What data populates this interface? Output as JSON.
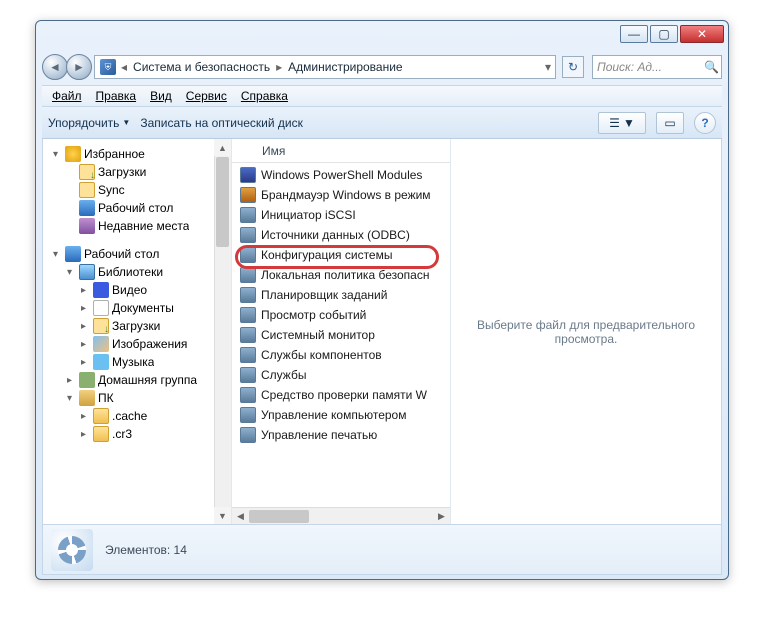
{
  "breadcrumb": {
    "level1": "Система и безопасность",
    "level2": "Администрирование"
  },
  "search": {
    "placeholder": "Поиск: Ад..."
  },
  "menu": {
    "file": "Файл",
    "edit": "Правка",
    "view": "Вид",
    "tools": "Сервис",
    "help": "Справка"
  },
  "toolbar": {
    "organize": "Упорядочить",
    "burn": "Записать на оптический диск"
  },
  "nav": {
    "favorites": "Избранное",
    "downloads": "Загрузки",
    "sync": "Sync",
    "desktop": "Рабочий стол",
    "recent": "Недавние места",
    "desktop2": "Рабочий стол",
    "libraries": "Библиотеки",
    "videos": "Видео",
    "documents": "Документы",
    "downloads2": "Загрузки",
    "pictures": "Изображения",
    "music": "Музыка",
    "homegroup": "Домашняя группа",
    "pc": "ПК",
    "cache": ".cache",
    "cr3": ".cr3"
  },
  "column": {
    "name": "Имя"
  },
  "files": {
    "f0": "Windows PowerShell Modules",
    "f1": "Брандмауэр Windows в режим",
    "f2": "Инициатор iSCSI",
    "f3": "Источники данных (ODBC)",
    "f4": "Конфигурация системы",
    "f5": "Локальная политика безопасн",
    "f6": "Планировщик заданий",
    "f7": "Просмотр событий",
    "f8": "Системный монитор",
    "f9": "Службы компонентов",
    "f10": "Службы",
    "f11": "Средство проверки памяти W",
    "f12": "Управление компьютером",
    "f13": "Управление печатью"
  },
  "preview": {
    "text": "Выберите файл для предварительного просмотра."
  },
  "status": {
    "label": "Элементов:",
    "count": "14"
  }
}
